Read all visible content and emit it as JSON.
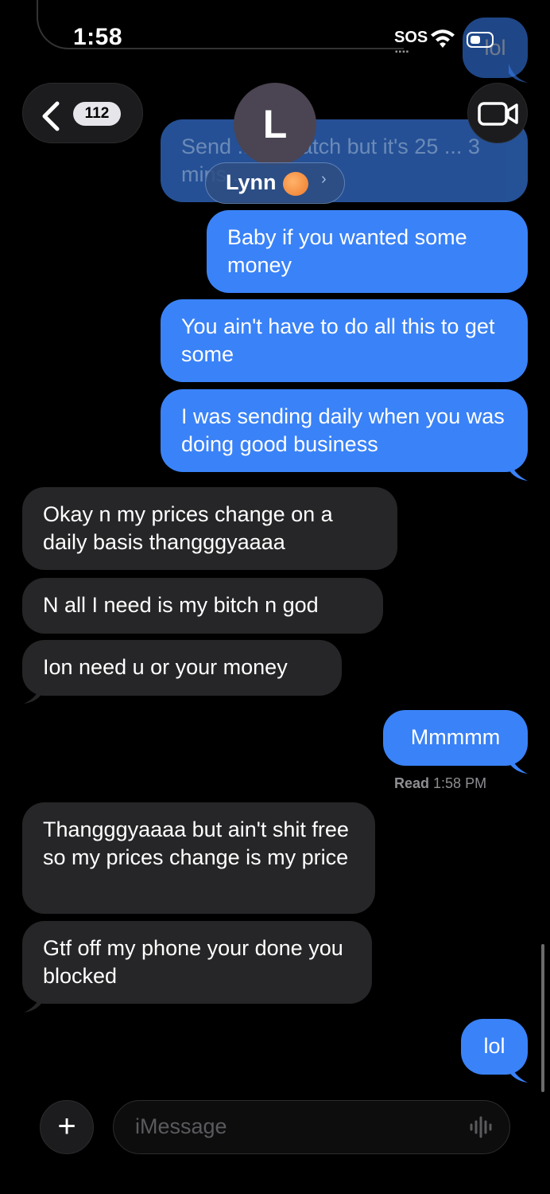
{
  "status_bar": {
    "time": "1:58",
    "sos": "SOS"
  },
  "header": {
    "back_count": "112",
    "avatar_initial": "L",
    "contact_name": "Lynn"
  },
  "messages": [
    {
      "direction": "outgoing",
      "text": "Send ... to watch but it's 25 ... 3 mins..",
      "partially_hidden": true
    },
    {
      "direction": "outgoing",
      "text": "Baby if you wanted some money"
    },
    {
      "direction": "outgoing",
      "text": "You ain't have to do all this to get some"
    },
    {
      "direction": "outgoing",
      "text": "I was sending daily when you was doing good business"
    },
    {
      "direction": "incoming",
      "text": "Okay n my prices change on a daily basis thangggyaaaa"
    },
    {
      "direction": "incoming",
      "text": "N all I need is my bitch n god"
    },
    {
      "direction": "incoming",
      "text": "Ion need u or your money"
    },
    {
      "direction": "outgoing",
      "text": "Mmmmm"
    },
    {
      "direction": "incoming",
      "text": "Thangggyaaaa but ain't shit free so my prices change is my price"
    },
    {
      "direction": "incoming",
      "text": "Gtf off my phone your done you blocked"
    },
    {
      "direction": "outgoing",
      "text": "lol"
    }
  ],
  "read_receipt": {
    "label": "Read",
    "time": "1:58 PM"
  },
  "ghost_bubble_text": "lol",
  "composer": {
    "placeholder": "iMessage",
    "add_symbol": "+"
  },
  "icons": [
    "back-chevron-icon",
    "video-camera-icon",
    "wifi-icon",
    "battery-icon",
    "audio-waveform-icon",
    "plus-icon"
  ],
  "colors": {
    "outgoing_bubble": "#3a82f7",
    "incoming_bubble": "#262628",
    "background": "#000000"
  }
}
